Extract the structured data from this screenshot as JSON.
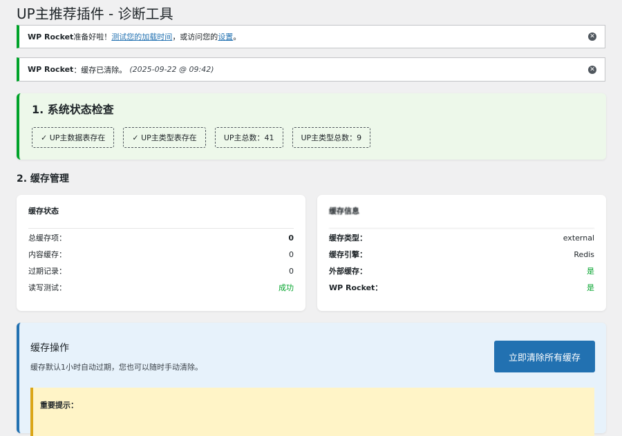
{
  "page": {
    "title": "UP主推荐插件 - 诊断工具"
  },
  "notices": {
    "ready": {
      "brand": "WP Rocket",
      "text_before": "准备好啦！",
      "link1": "测试您的加载时间",
      "text_mid": "，或访问您的",
      "link2": "设置",
      "text_after": "。"
    },
    "cleared": {
      "brand": "WP Rocket",
      "text": "：缓存已清除。",
      "timestamp": "(2025-09-22 @ 09:42)"
    },
    "dismiss_glyph": "✕"
  },
  "status_check": {
    "title": "1. 系统状态检查",
    "chips": [
      "✓ UP主数据表存在",
      "✓ UP主类型表存在",
      "UP主总数：41",
      "UP主类型总数：9"
    ]
  },
  "cache_section": {
    "title": "2. 缓存管理"
  },
  "cache_status": {
    "title": "缓存状态",
    "rows": [
      {
        "label": "总缓存项：",
        "value": "0"
      },
      {
        "label": "内容缓存：",
        "value": "0"
      },
      {
        "label": "过期记录：",
        "value": "0"
      },
      {
        "label": "读写测试：",
        "value": "成功"
      }
    ]
  },
  "cache_info": {
    "title": "缓存信息",
    "rows": [
      {
        "label": "缓存类型：",
        "value": "external"
      },
      {
        "label": "缓存引擎：",
        "value": "Redis"
      },
      {
        "label": "外部缓存：",
        "value": "是"
      },
      {
        "label": "WP Rocket：",
        "value": "是"
      }
    ]
  },
  "cache_actions": {
    "title": "缓存操作",
    "description": "缓存默认1小时自动过期，您也可以随时手动清除。",
    "clear_button": "立即清除所有缓存",
    "warning_title": "重要提示："
  },
  "colors": {
    "success": "#00a32a",
    "primary": "#2271b1",
    "warning": "#dba617"
  }
}
